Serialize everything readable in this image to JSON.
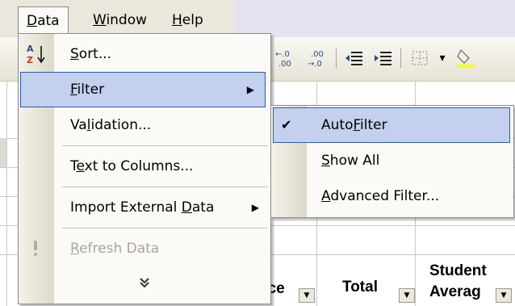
{
  "menubar": {
    "items": [
      {
        "label": "Data",
        "mnemonic": "D",
        "rest": "ata"
      },
      {
        "label": "Window",
        "mnemonic": "W",
        "rest": "indow"
      },
      {
        "label": "Help",
        "mnemonic": "H",
        "rest": "elp"
      }
    ]
  },
  "toolbar": {
    "buttons": [
      {
        "name": "increase-decimal-icon",
        "glyph": "←.0\n.00"
      },
      {
        "name": "decrease-decimal-icon",
        "glyph": ".00\n→.0"
      },
      {
        "name": "decrease-indent-icon",
        "glyph": "⇤"
      },
      {
        "name": "increase-indent-icon",
        "glyph": "⇥"
      },
      {
        "name": "borders-icon",
        "glyph": "⊞"
      },
      {
        "name": "dropdown-arrow-icon",
        "glyph": "▾"
      }
    ]
  },
  "data_menu": {
    "items": [
      {
        "before": "",
        "mnemonic": "S",
        "after": "ort...",
        "icon": "sort-az-icon"
      },
      {
        "before": "",
        "mnemonic": "F",
        "after": "ilter",
        "has_submenu": true,
        "highlighted": true
      },
      {
        "before": "Va",
        "mnemonic": "l",
        "after": "idation..."
      },
      {
        "before": "T",
        "mnemonic": "e",
        "after": "xt to Columns..."
      },
      {
        "before": "Import External ",
        "mnemonic": "D",
        "after": "ata",
        "has_submenu": true
      },
      {
        "before": "",
        "mnemonic": "R",
        "after": "efresh Data",
        "disabled": true,
        "icon": "refresh-icon"
      }
    ],
    "expand_glyph": "»"
  },
  "filter_submenu": {
    "items": [
      {
        "before": "Auto",
        "mnemonic": "F",
        "after": "ilter",
        "checked": true,
        "highlighted": true
      },
      {
        "before": "",
        "mnemonic": "S",
        "after": "how All"
      },
      {
        "before": "",
        "mnemonic": "A",
        "after": "dvanced Filter..."
      }
    ]
  },
  "sheet": {
    "headers": [
      {
        "label": "nce"
      },
      {
        "label": "Total"
      },
      {
        "line1": "Student",
        "line2": "Averag"
      }
    ]
  },
  "colors": {
    "highlight": "#c3d0ee",
    "highlight_border": "#2f5aa8",
    "menu_bg": "#fbfaf6"
  }
}
